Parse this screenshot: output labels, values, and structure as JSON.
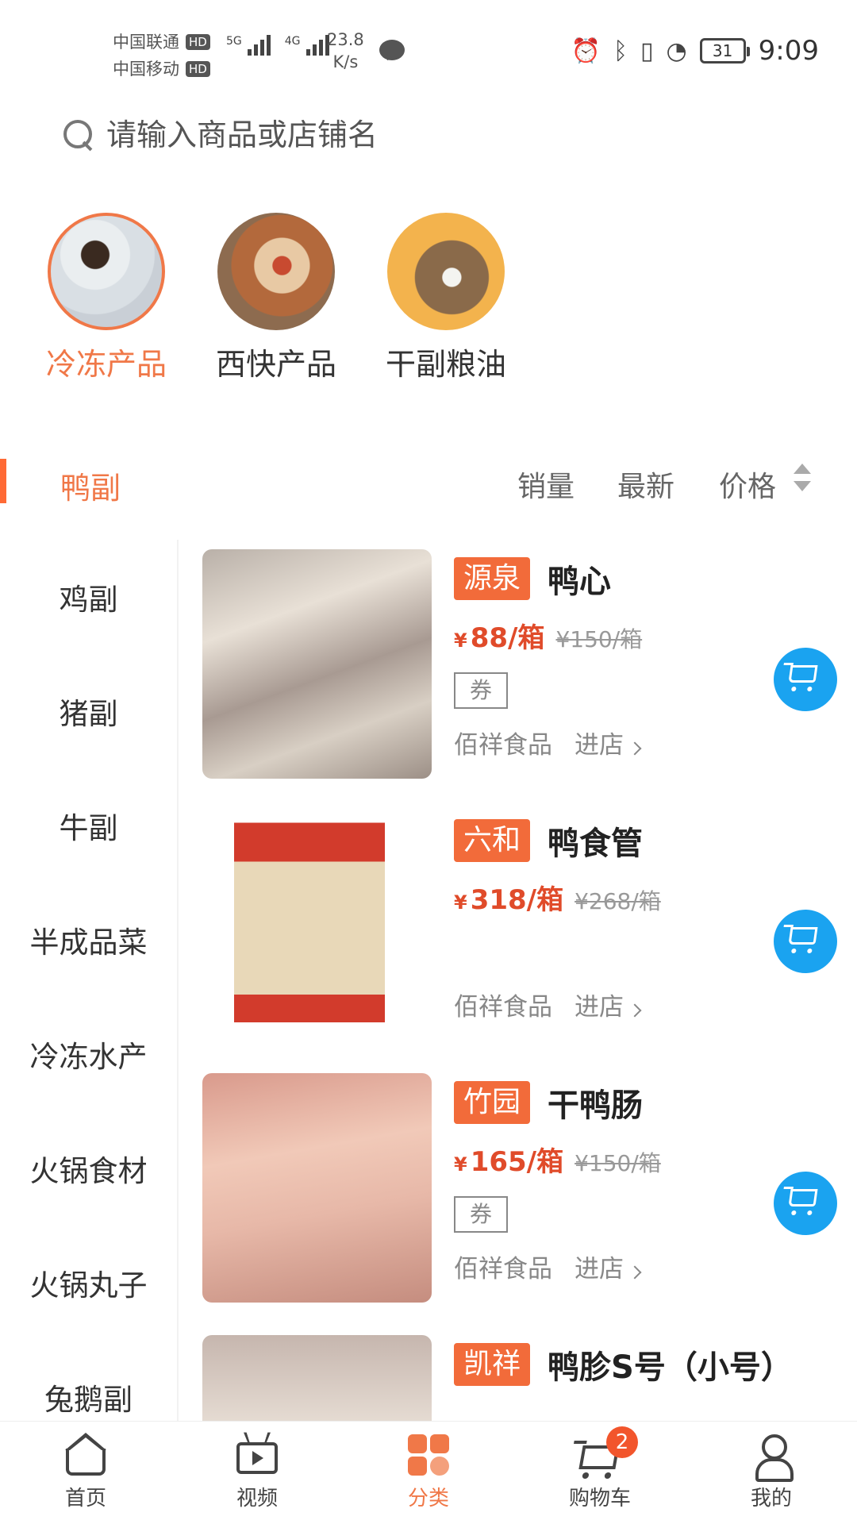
{
  "status_bar": {
    "carrier1": "中国联通",
    "carrier2": "中国移动",
    "hd_label": "HD",
    "sig1_label": "5G",
    "sig2_label": "4G",
    "speed_value": "23.8",
    "speed_unit": "K/s",
    "battery": "31",
    "time": "9:09"
  },
  "search": {
    "placeholder": "请输入商品或店铺名"
  },
  "top_categories": [
    {
      "label": "冷冻产品",
      "active": true
    },
    {
      "label": "西快产品",
      "active": false
    },
    {
      "label": "干副粮油",
      "active": false
    }
  ],
  "sort": {
    "active_sub": "鸭副",
    "sales": "销量",
    "newest": "最新",
    "price": "价格"
  },
  "sidebar": {
    "items": [
      "鸡副",
      "猪副",
      "牛副",
      "半成品菜",
      "冷冻水产",
      "火锅食材",
      "火锅丸子",
      "兔鹅副"
    ]
  },
  "products": [
    {
      "brand": "源泉",
      "name": "鸭心",
      "yen": "¥",
      "price": "88/箱",
      "old_price": "¥150/箱",
      "coupon": "券",
      "shop": "佰祥食品",
      "enter": "进店"
    },
    {
      "brand": "六和",
      "name": "鸭食管",
      "yen": "¥",
      "price": "318/箱",
      "old_price": "¥268/箱",
      "shop": "佰祥食品",
      "enter": "进店"
    },
    {
      "brand": "竹园",
      "name": "干鸭肠",
      "yen": "¥",
      "price": "165/箱",
      "old_price": "¥150/箱",
      "coupon": "券",
      "shop": "佰祥食品",
      "enter": "进店"
    },
    {
      "brand": "凯祥",
      "name": "鸭胗S号（小号）"
    }
  ],
  "bottom_nav": {
    "home": "首页",
    "video": "视频",
    "category": "分类",
    "cart": "购物车",
    "cart_badge": "2",
    "mine": "我的"
  },
  "colors": {
    "accent": "#f07848",
    "brand_tag": "#f26b3a",
    "price": "#e04b2a",
    "cart_button": "#1aa3f0"
  }
}
